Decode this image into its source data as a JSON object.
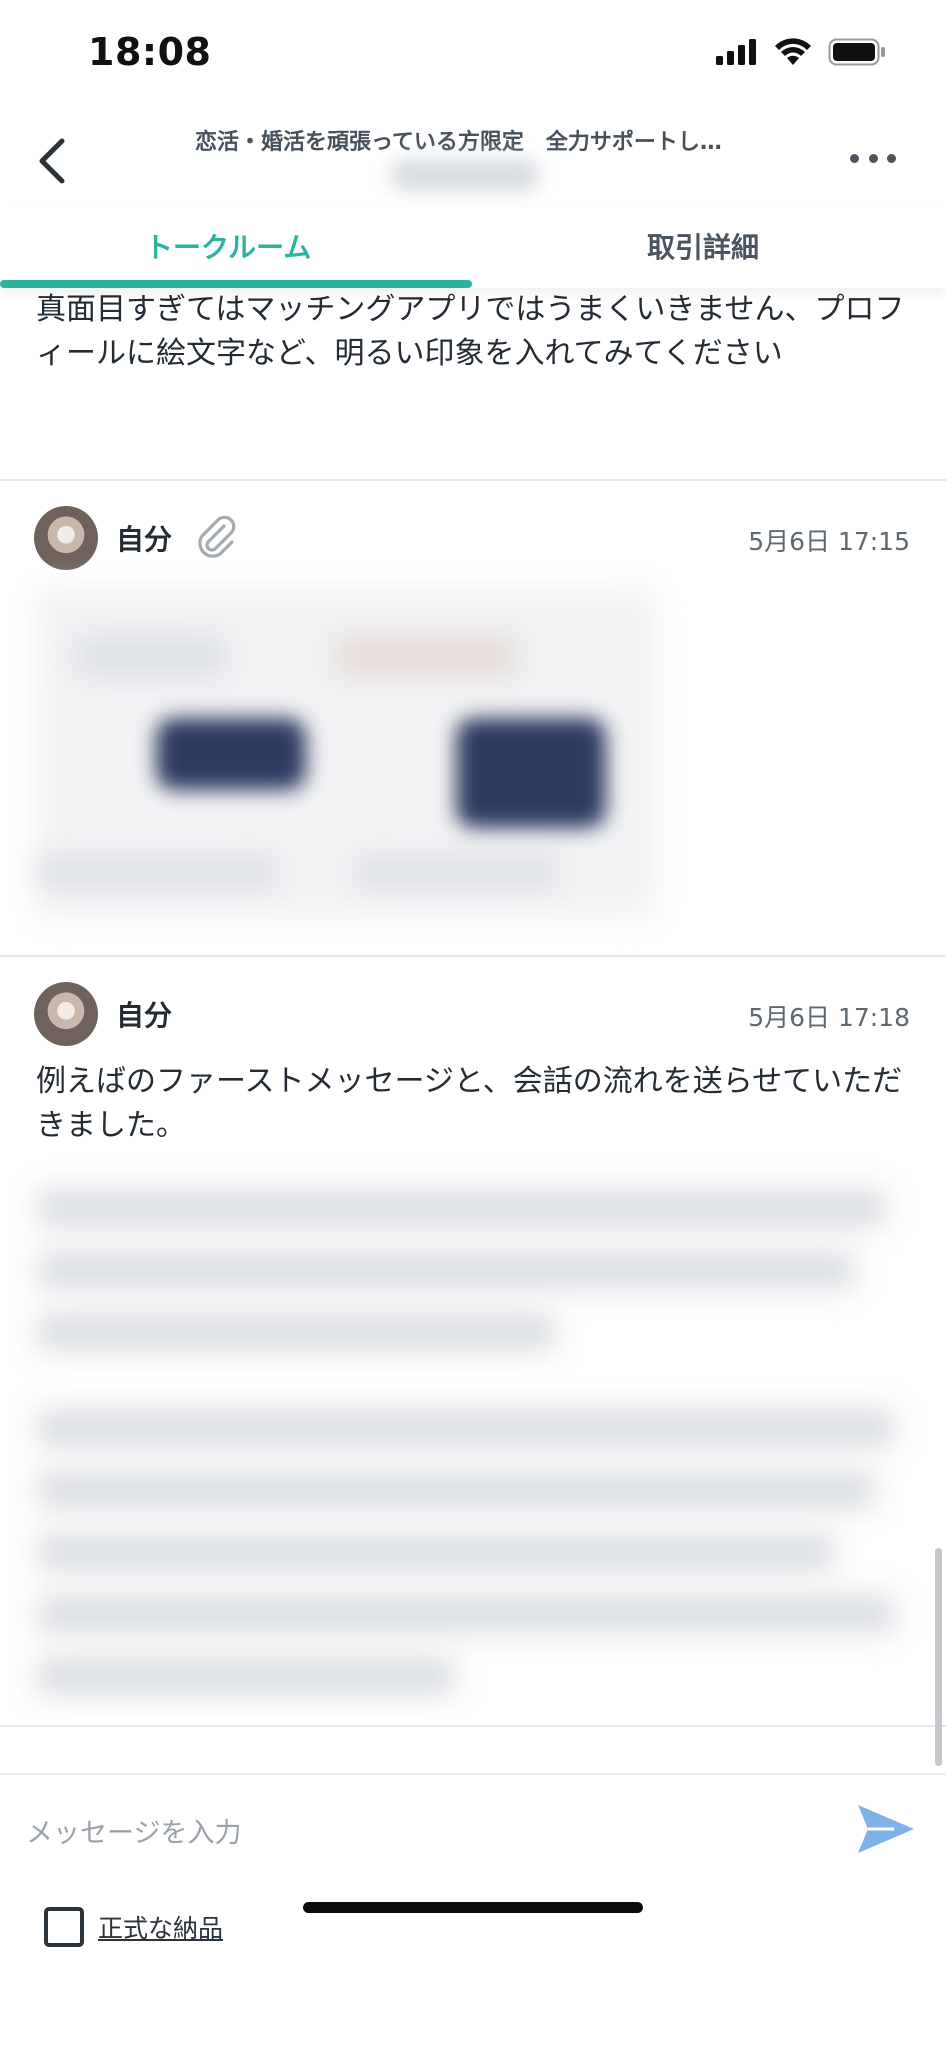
{
  "status_bar": {
    "time": "18:08"
  },
  "nav": {
    "title": "恋活・婚活を頑張っている方限定　全力サポートし…",
    "back_icon": "chevron-left-icon",
    "more_icon": "more-horizontal-icon"
  },
  "tabs": [
    {
      "label": "トークルーム",
      "active": true
    },
    {
      "label": "取引詳細",
      "active": false
    }
  ],
  "messages": [
    {
      "text": "真面目すぎてはマッチングアプリではうまくいきません、プロフィールに絵文字など、明るい印象を入れてみてください"
    },
    {
      "sender": "自分",
      "time": "5月6日 17:15",
      "attachment_icon": "paperclip-icon"
    },
    {
      "sender": "自分",
      "time": "5月6日 17:18",
      "text": "例えばのファーストメッセージと、会話の流れを送らせていただきました。"
    }
  ],
  "composer": {
    "placeholder": "メッセージを入力",
    "send_icon": "send-icon",
    "formal_delivery_label": "正式な納品"
  },
  "colors": {
    "accent": "#2bb3a0",
    "send": "#7fb2e8",
    "text": "#232c35"
  }
}
